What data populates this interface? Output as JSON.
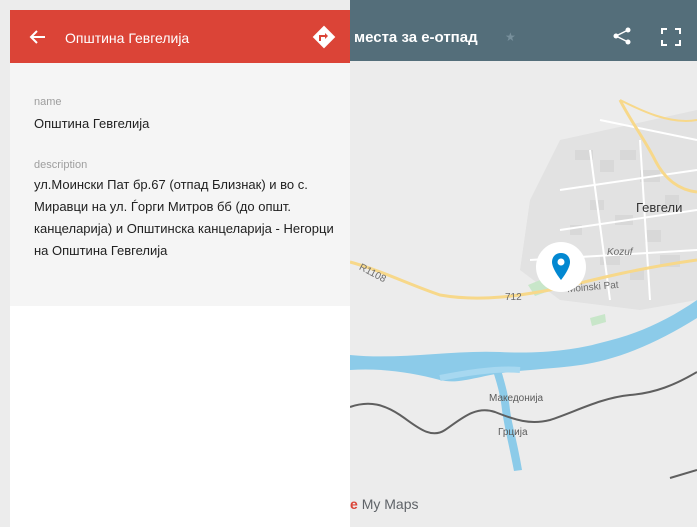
{
  "map": {
    "title": "места за е-отпад",
    "footer_brand": "e",
    "footer_text": "My Maps",
    "labels": {
      "city": "Гевгели",
      "kozuf": "Kozuf",
      "road_r1108": "R1108",
      "road_712": "712",
      "street": "Moinski Pat",
      "country_mk": "Македонија",
      "country_gr": "Грција"
    }
  },
  "panel": {
    "title": "Општина Гевгелија",
    "name_label": "name",
    "name_value": "Општина Гевгелија",
    "description_label": "description",
    "description_value": "ул.Моински Пат бр.67 (отпад Близнак) и во с. Миравци на ул. Ѓорги Митров бб (до општ. канцеларија) и Општинска канцеларија - Негорци на Општина Гевгелија"
  },
  "colors": {
    "header_red": "#db4437",
    "topbar": "#546e7a",
    "pin": "#0288d1",
    "river": "#7ec3e6",
    "land": "#ededed",
    "road_major": "#f7d88a",
    "border": "#616161"
  },
  "icons": {
    "back": "back-arrow-icon",
    "directions": "directions-icon",
    "share": "share-icon",
    "fullscreen": "fullscreen-icon",
    "pin": "map-pin-icon",
    "star": "star-icon"
  }
}
